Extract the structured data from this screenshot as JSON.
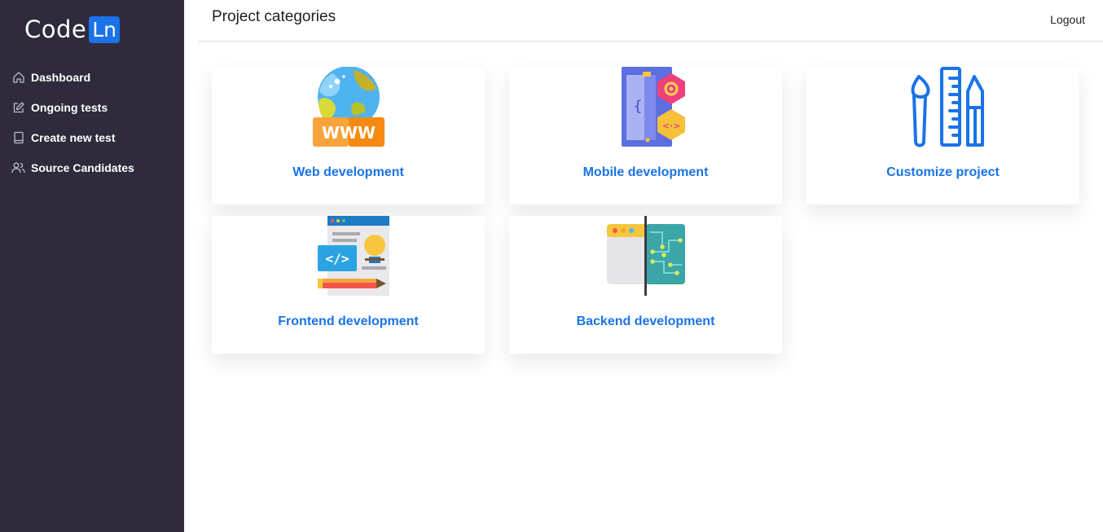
{
  "sidebar": {
    "logo": {
      "text": "Code",
      "boxed": "Ln"
    },
    "items": [
      {
        "label": "Dashboard",
        "icon": "home-icon"
      },
      {
        "label": "Ongoing tests",
        "icon": "edit-icon"
      },
      {
        "label": "Create new test",
        "icon": "book-icon"
      },
      {
        "label": "Source Candidates",
        "icon": "users-icon"
      }
    ]
  },
  "header": {
    "title": "Project categories",
    "logout_label": "Logout"
  },
  "categories": [
    {
      "label": "Web development",
      "icon": "www-globe-icon"
    },
    {
      "label": "Mobile development",
      "icon": "mobile-app-icon"
    },
    {
      "label": "Customize project",
      "icon": "design-tools-icon"
    },
    {
      "label": "Frontend development",
      "icon": "frontend-code-icon"
    },
    {
      "label": "Backend development",
      "icon": "backend-circuit-icon"
    }
  ],
  "colors": {
    "sidebar_bg": "#2f2b3c",
    "accent": "#1a73e8",
    "text_dark": "#1f1f1f"
  }
}
